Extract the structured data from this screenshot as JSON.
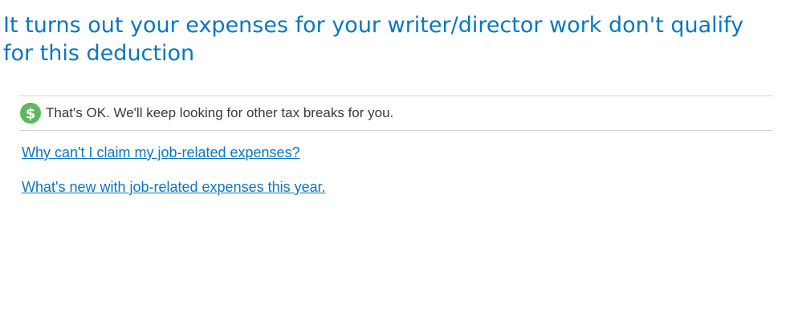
{
  "header": {
    "title": "It turns out your expenses for your writer/director work don't qualify for this deduction"
  },
  "info_box": {
    "icon": "dollar-icon",
    "icon_color": "#5cb85c",
    "message": "That's OK. We'll keep looking for other tax breaks for you."
  },
  "links": [
    {
      "label": "Why can't I claim my job-related expenses?"
    },
    {
      "label": "What's new with job-related expenses this year."
    }
  ],
  "colors": {
    "accent": "#0a77c2",
    "text": "#393a3d",
    "divider": "#d4d7d9"
  }
}
